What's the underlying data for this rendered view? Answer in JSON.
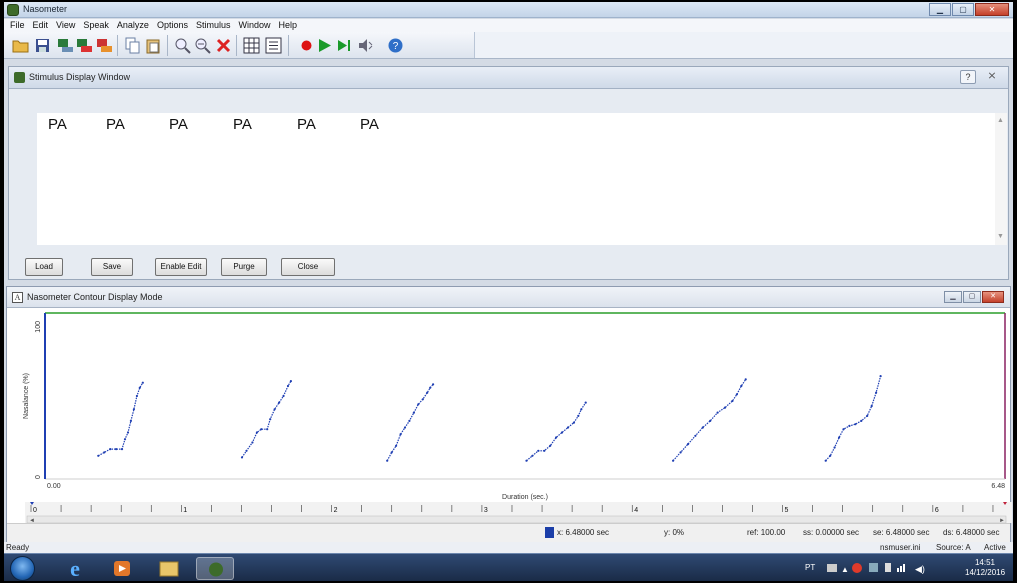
{
  "window": {
    "title": "Nasometer"
  },
  "menu": [
    "File",
    "Edit",
    "View",
    "Speak",
    "Analyze",
    "Options",
    "Stimulus",
    "Window",
    "Help"
  ],
  "toolbar_icons": [
    "open-folder-icon",
    "save-icon",
    "pc-icon",
    "pc-red-icon",
    "pc-orange-icon",
    "copy-icon",
    "paste-icon",
    "zoom-out-icon",
    "zoom-in-icon",
    "delete-icon",
    "grid-icon",
    "list-icon",
    "record-icon",
    "play-icon",
    "play-selection-icon",
    "speaker-icon",
    "help-icon"
  ],
  "stimulus_window": {
    "title": "Stimulus Display Window",
    "help": "?",
    "close": "⨯",
    "words": [
      "PA",
      "PA",
      "PA",
      "PA",
      "PA",
      "PA"
    ],
    "buttons": {
      "load": "Load",
      "save": "Save",
      "enable_edit": "Enable Edit",
      "purge": "Purge",
      "close": "Close"
    }
  },
  "contour_window": {
    "icon_letter": "A",
    "title": "Nasometer Contour Display Mode"
  },
  "chart_data": {
    "type": "scatter",
    "xlabel": "Duration (sec.)",
    "ylabel": "Nasalance (%)",
    "xlim": [
      0,
      6.48
    ],
    "ylim": [
      0,
      100
    ],
    "x_start_label": "0.00",
    "x_end_label": "6.48",
    "y_bottom_label": "0",
    "y_top_label": "100",
    "ruler_labels": [
      "0",
      "1",
      "2",
      "3",
      "4",
      "5",
      "6"
    ],
    "color": "#1f3fb3",
    "series": [
      {
        "x": [
          0.36,
          0.4,
          0.44,
          0.48,
          0.52,
          0.54,
          0.56,
          0.58,
          0.6,
          0.62,
          0.64,
          0.66
        ],
        "y": [
          14,
          16,
          18,
          18,
          18,
          24,
          28,
          35,
          42,
          50,
          55,
          58
        ]
      },
      {
        "x": [
          1.33,
          1.36,
          1.4,
          1.43,
          1.46,
          1.5,
          1.52,
          1.55,
          1.58,
          1.61,
          1.64,
          1.66
        ],
        "y": [
          13,
          17,
          22,
          28,
          30,
          30,
          36,
          42,
          46,
          50,
          56,
          59
        ]
      },
      {
        "x": [
          2.31,
          2.34,
          2.37,
          2.4,
          2.43,
          2.46,
          2.49,
          2.52,
          2.55,
          2.58,
          2.6,
          2.62
        ],
        "y": [
          11,
          16,
          20,
          27,
          31,
          35,
          40,
          45,
          48,
          52,
          55,
          57
        ]
      },
      {
        "x": [
          3.25,
          3.29,
          3.33,
          3.37,
          3.41,
          3.45,
          3.49,
          3.53,
          3.57,
          3.6,
          3.62,
          3.65
        ],
        "y": [
          11,
          14,
          17,
          17,
          20,
          25,
          28,
          31,
          34,
          38,
          42,
          46
        ]
      },
      {
        "x": [
          4.24,
          4.29,
          4.34,
          4.39,
          4.44,
          4.49,
          4.54,
          4.59,
          4.64,
          4.67,
          4.7,
          4.73
        ],
        "y": [
          11,
          16,
          21,
          26,
          31,
          35,
          40,
          43,
          47,
          51,
          56,
          60
        ]
      },
      {
        "x": [
          5.27,
          5.3,
          5.33,
          5.36,
          5.39,
          5.43,
          5.47,
          5.51,
          5.55,
          5.58,
          5.61,
          5.64
        ],
        "y": [
          11,
          14,
          19,
          25,
          30,
          32,
          33,
          35,
          38,
          44,
          52,
          62
        ]
      }
    ]
  },
  "info_strip": {
    "x": "x: 6.48000 sec",
    "y": "y: 0%",
    "ref": "ref: 100.00",
    "ss": "ss: 0.00000 sec",
    "se": "se: 6.48000 sec",
    "ds": "ds: 6.48000 sec"
  },
  "statusbar": {
    "left": "Ready",
    "file": "nsmuser.ini",
    "source": "Source: A",
    "active": "Active"
  },
  "tray": {
    "lang": "PT",
    "time": "14:51",
    "date": "14/12/2016"
  }
}
